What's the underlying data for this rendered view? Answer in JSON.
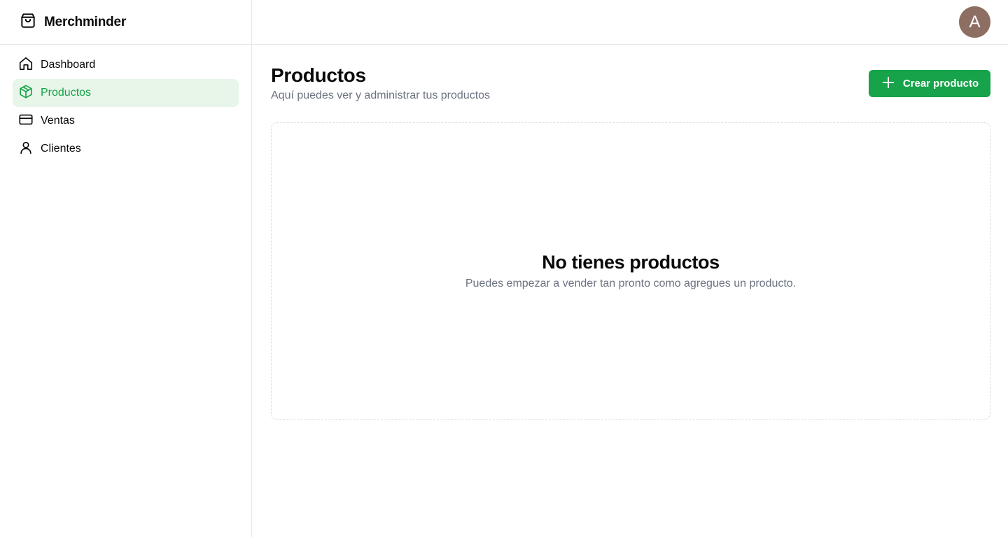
{
  "brand": {
    "name": "Merchminder",
    "icon": "store-icon"
  },
  "sidebar": {
    "items": [
      {
        "label": "Dashboard",
        "icon": "home-icon",
        "active": false
      },
      {
        "label": "Productos",
        "icon": "package-icon",
        "active": true
      },
      {
        "label": "Ventas",
        "icon": "credit-card-icon",
        "active": false
      },
      {
        "label": "Clientes",
        "icon": "user-icon",
        "active": false
      }
    ]
  },
  "header": {
    "avatar_initial": "A",
    "avatar_color": "#8d6e63"
  },
  "page": {
    "title": "Productos",
    "subtitle": "Aquí puedes ver y administrar tus productos",
    "create_label": "Crear producto"
  },
  "empty_state": {
    "title": "No tienes productos",
    "description": "Puedes empezar a vender tan pronto como agregues un producto."
  },
  "colors": {
    "accent": "#16a34a",
    "active_bg": "#e8f5e9",
    "muted_text": "#6b7280"
  }
}
